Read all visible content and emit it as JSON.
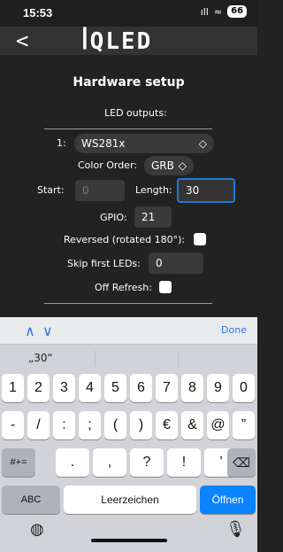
{
  "status": {
    "time": "15:53",
    "signal": "ıll",
    "wifi": "≈",
    "battery": "66"
  },
  "app": {
    "back": "<",
    "logo": "ꟾQLED"
  },
  "page": {
    "title": "Hardware setup",
    "section": "LED outputs:",
    "led_index": "1:",
    "led_type": "WS281x",
    "color_order_label": "Color Order:",
    "color_order_value": "GRB",
    "start_label": "Start:",
    "start_value": "0",
    "length_label": "Length:",
    "length_value": "30",
    "gpio_label": "GPIO:",
    "gpio_value": "21",
    "reversed_label": "Reversed (rotated 180°):",
    "skip_label": "Skip first LEDs:",
    "skip_value": "0",
    "off_refresh_label": "Off Refresh:"
  },
  "keyboard": {
    "done": "Done",
    "prediction": "„30“",
    "row1": [
      "1",
      "2",
      "3",
      "4",
      "5",
      "6",
      "7",
      "8",
      "9",
      "0"
    ],
    "row2": [
      "-",
      "/",
      ":",
      ";",
      "(",
      ")",
      "€",
      "&",
      "@",
      "”"
    ],
    "row3": [
      "#+=",
      ".",
      ",",
      "?",
      "!",
      "’",
      "⌫"
    ],
    "row4": [
      "ABC",
      "Leerzeichen",
      "Öffnen"
    ]
  }
}
